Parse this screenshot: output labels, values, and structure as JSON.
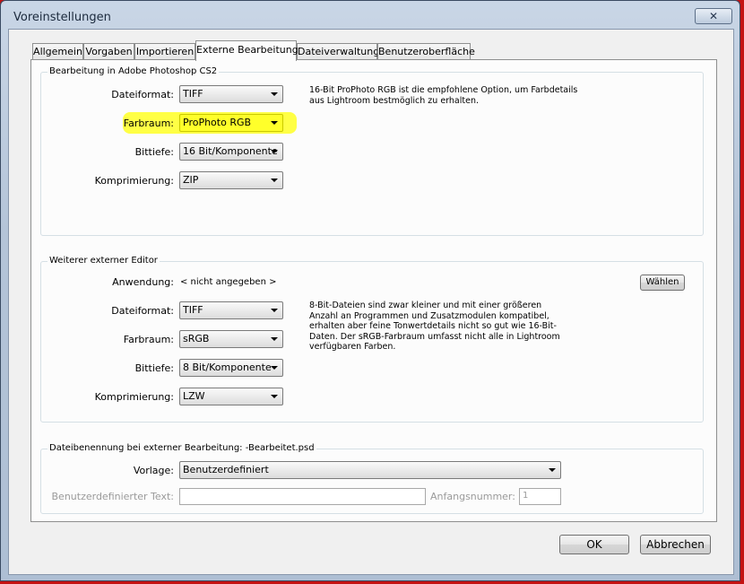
{
  "window": {
    "title": "Voreinstellungen",
    "close_label": "✕"
  },
  "tabs": [
    {
      "label": "Allgemein"
    },
    {
      "label": "Vorgaben"
    },
    {
      "label": "Importieren"
    },
    {
      "label": "Externe Bearbeitung",
      "active": true
    },
    {
      "label": "Dateiverwaltung"
    },
    {
      "label": "Benutzeroberfläche"
    }
  ],
  "photoshop": {
    "legend": "Bearbeitung in Adobe Photoshop CS2",
    "dateiformat_label": "Dateiformat:",
    "dateiformat": "TIFF",
    "farbraum_label": "Farbraum:",
    "farbraum": "ProPhoto RGB",
    "bittiefe_label": "Bittiefe:",
    "bittiefe": "16 Bit/Komponente",
    "komprimierung_label": "Komprimierung:",
    "komprimierung": "ZIP",
    "note": "16-Bit ProPhoto RGB ist die empfohlene Option, um Farbdetails aus Lightroom bestmöglich zu erhalten.",
    "highlight_color": "#ffff3b"
  },
  "external": {
    "legend": "Weiterer externer Editor",
    "anwendung_label": "Anwendung:",
    "anwendung": "< nicht angegeben >",
    "waehlen_label": "Wählen",
    "dateiformat_label": "Dateiformat:",
    "dateiformat": "TIFF",
    "farbraum_label": "Farbraum:",
    "farbraum": "sRGB",
    "bittiefe_label": "Bittiefe:",
    "bittiefe": "8 Bit/Komponente",
    "komprimierung_label": "Komprimierung:",
    "komprimierung": "LZW",
    "note": "8-Bit-Dateien sind zwar kleiner und mit einer größeren Anzahl an Programmen und Zusatzmodulen kompatibel, erhalten aber feine Tonwertdetails nicht so gut wie 16-Bit-Daten. Der sRGB-Farbraum umfasst nicht alle in Lightroom verfügbaren Farben."
  },
  "naming": {
    "legend": "Dateibenennung bei externer Bearbeitung: -Bearbeitet.psd",
    "vorlage_label": "Vorlage:",
    "vorlage": "Benutzerdefiniert",
    "custom_text_label": "Benutzerdefinierter Text:",
    "custom_text_value": "",
    "start_number_label": "Anfangsnummer:",
    "start_number_value": "1"
  },
  "footer": {
    "ok_label": "OK",
    "cancel_label": "Abbrechen"
  },
  "colors": {
    "frame_accent": "#c41212",
    "highlight": "#ffff3b"
  }
}
